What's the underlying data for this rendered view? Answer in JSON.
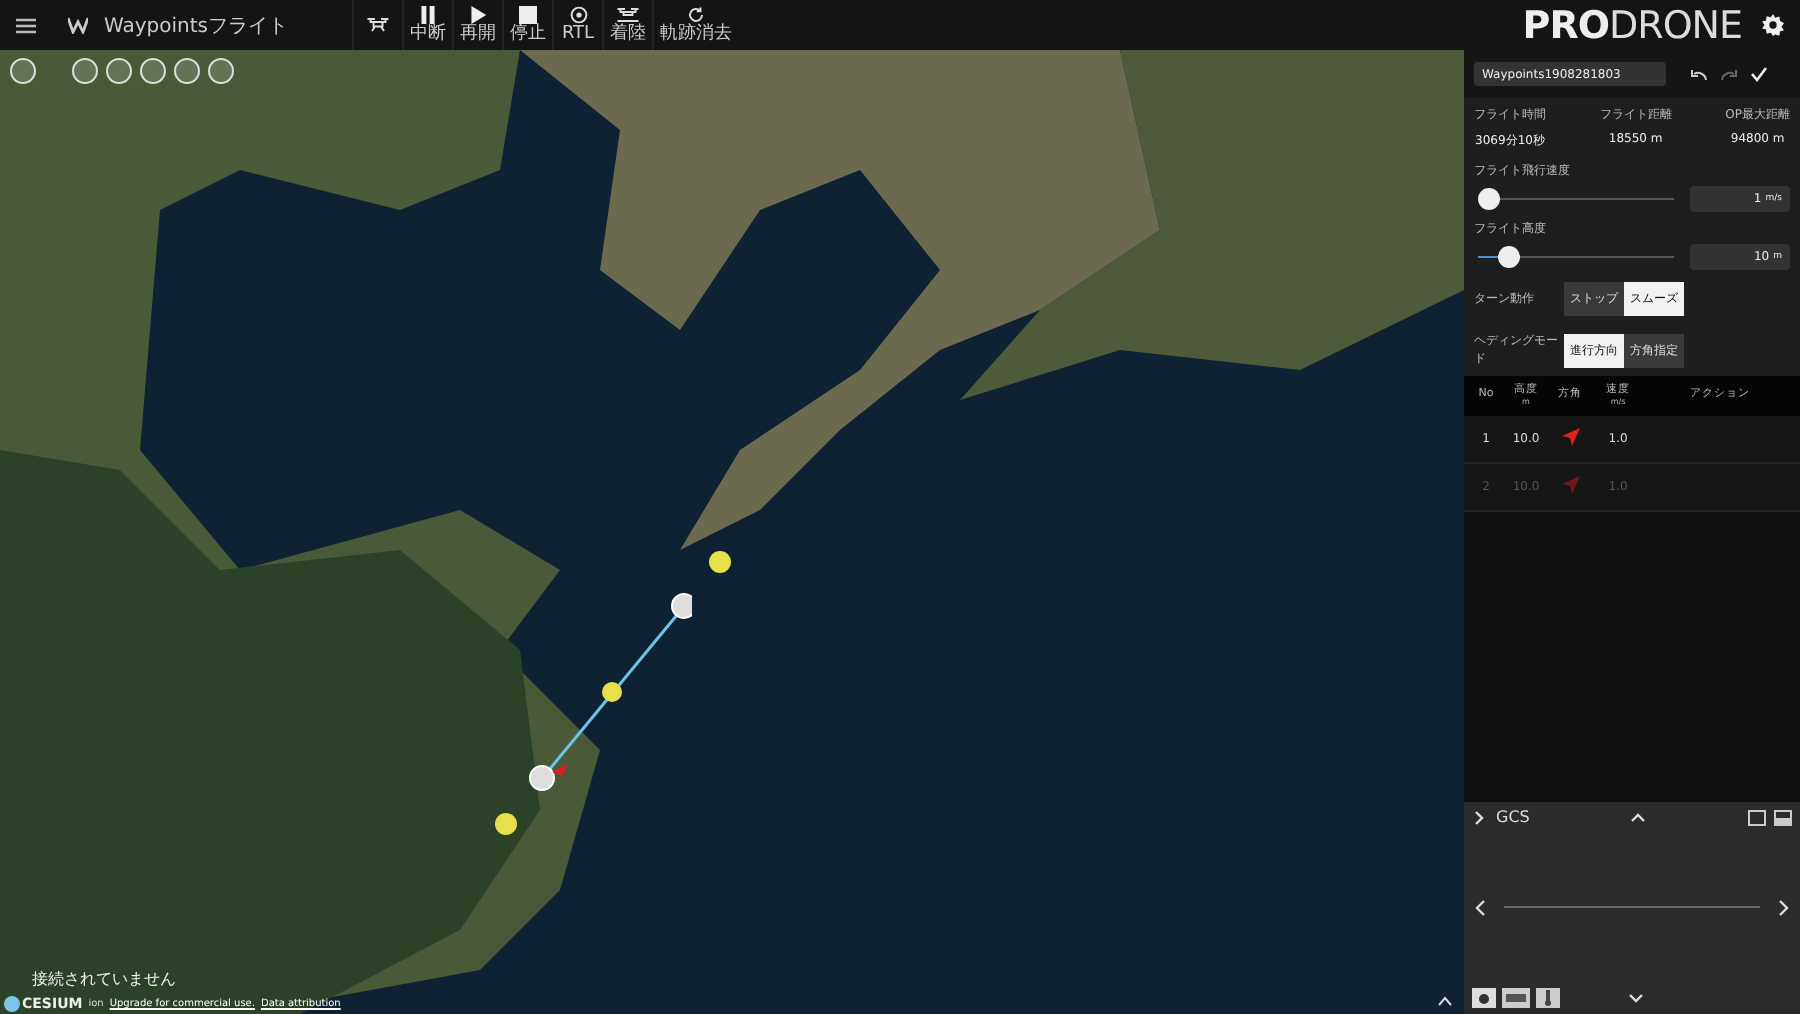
{
  "top_bar": {
    "title": "Waypointsフライト",
    "tools": [
      {
        "kind": "drone"
      },
      {
        "kind": "pause",
        "label": "中断"
      },
      {
        "kind": "play",
        "label": "再開"
      },
      {
        "kind": "stop",
        "label": "停止"
      },
      {
        "kind": "rtl",
        "label": "RTL"
      },
      {
        "kind": "land",
        "label": "着陸"
      },
      {
        "kind": "clear",
        "label": "軌跡消去"
      }
    ],
    "brand_bold": "PRO",
    "brand_light": "DRONE"
  },
  "map": {
    "status": "接続されていません",
    "attribution_logo": "CESIUM",
    "attribution_ion": "ion",
    "attribution_links": [
      "Upgrade for commercial use.",
      "Data attribution"
    ]
  },
  "panel": {
    "name_value": "Waypoints1908281803",
    "stats": [
      {
        "label": "フライト時間",
        "value": "3069分10秒"
      },
      {
        "label": "フライト距離",
        "value": "18550 m"
      },
      {
        "label": "OP最大距離",
        "value": "94800 m"
      }
    ],
    "sliders": [
      {
        "label": "フライト飛行速度",
        "level": 0.0,
        "value": "1",
        "unit": "m/s"
      },
      {
        "label": "フライト高度",
        "level": 0.12,
        "value": "10",
        "unit": "m"
      }
    ],
    "toggles": [
      {
        "label": "ターン動作",
        "options": [
          {
            "label": "ストップ",
            "selected": false
          },
          {
            "label": "スムーズ",
            "selected": true
          }
        ]
      },
      {
        "label": "ヘディングモード",
        "options": [
          {
            "label": "進行方向",
            "selected": true
          },
          {
            "label": "方角指定",
            "selected": false
          }
        ]
      }
    ],
    "table": {
      "columns": [
        {
          "label": "No"
        },
        {
          "label": "高度",
          "unit": "m"
        },
        {
          "label": "方角"
        },
        {
          "label": "速度",
          "unit": "m/s"
        },
        {
          "label": "アクション"
        }
      ],
      "rows": [
        {
          "no": "1",
          "altitude": "10.0",
          "speed": "1.0",
          "disabled": false
        },
        {
          "no": "2",
          "altitude": "10.0",
          "speed": "1.0",
          "disabled": true
        }
      ]
    }
  },
  "gcs": {
    "title": "GCS"
  }
}
